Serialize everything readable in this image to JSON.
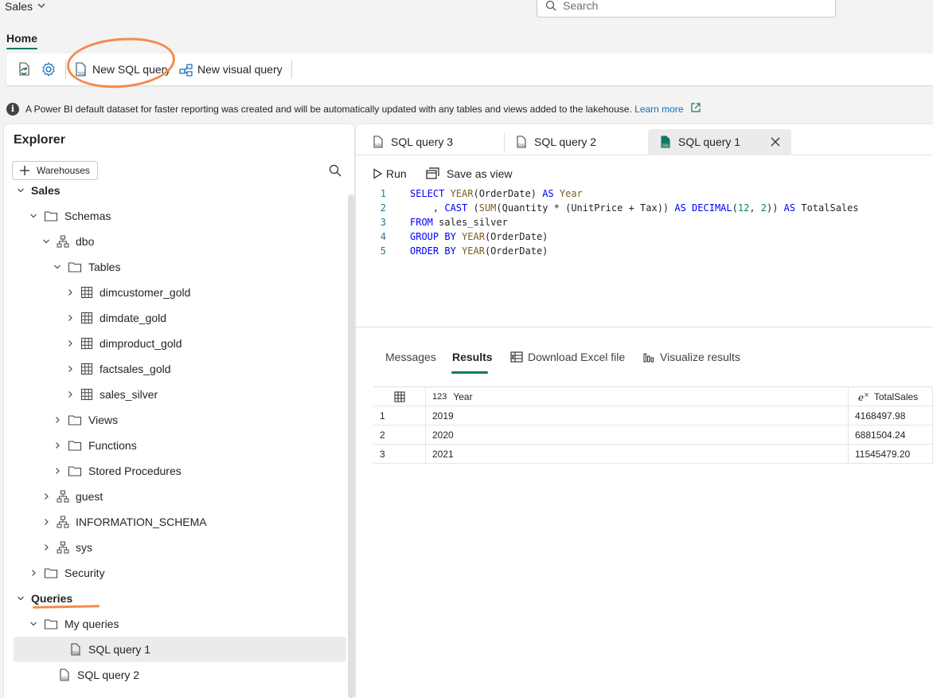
{
  "app": {
    "title": "Sales"
  },
  "search": {
    "placeholder": "Search"
  },
  "ribbon": {
    "tab_home": "Home",
    "new_sql_query": "New SQL query",
    "new_visual_query": "New visual query"
  },
  "info": {
    "message": "A Power BI default dataset for faster reporting was created and will be automatically updated with any tables and views added to the lakehouse.",
    "learn_more": "Learn more"
  },
  "explorer": {
    "title": "Explorer",
    "warehouses_button": "Warehouses",
    "tree": [
      {
        "label": "Sales"
      },
      {
        "label": "Schemas"
      },
      {
        "label": "dbo"
      },
      {
        "label": "Tables"
      },
      {
        "label": "dimcustomer_gold"
      },
      {
        "label": "dimdate_gold"
      },
      {
        "label": "dimproduct_gold"
      },
      {
        "label": "factsales_gold"
      },
      {
        "label": "sales_silver"
      },
      {
        "label": "Views"
      },
      {
        "label": "Functions"
      },
      {
        "label": "Stored Procedures"
      },
      {
        "label": "guest"
      },
      {
        "label": "INFORMATION_SCHEMA"
      },
      {
        "label": "sys"
      },
      {
        "label": "Security"
      },
      {
        "label": "Queries"
      },
      {
        "label": "My queries"
      },
      {
        "label": "SQL query 1"
      },
      {
        "label": "SQL query 2"
      }
    ]
  },
  "query_tabs": [
    {
      "label": "SQL query 3"
    },
    {
      "label": "SQL query 2"
    },
    {
      "label": "SQL query 1",
      "active": true
    }
  ],
  "editor_toolbar": {
    "run": "Run",
    "save_as_view": "Save as view"
  },
  "editor": {
    "lines": [
      {
        "num": "1",
        "parts": [
          [
            "kw",
            "SELECT "
          ],
          [
            "fn",
            "YEAR"
          ],
          [
            "",
            "(OrderDate) "
          ],
          [
            "kw",
            "AS "
          ],
          [
            "fn",
            "Year"
          ]
        ]
      },
      {
        "num": "2",
        "parts": [
          [
            "",
            "    , "
          ],
          [
            "kw",
            "CAST "
          ],
          [
            "",
            "("
          ],
          [
            "fn",
            "SUM"
          ],
          [
            "",
            "(Quantity * (UnitPrice + Tax)) "
          ],
          [
            "kw",
            "AS DECIMAL"
          ],
          [
            "",
            "("
          ],
          [
            "num",
            "12"
          ],
          [
            "",
            ", "
          ],
          [
            "num",
            "2"
          ],
          [
            "",
            "))"
          ],
          [
            "kw",
            " AS "
          ],
          [
            "",
            "TotalSales"
          ]
        ]
      },
      {
        "num": "3",
        "parts": [
          [
            "kw",
            "FROM "
          ],
          [
            "",
            "sales_silver"
          ]
        ]
      },
      {
        "num": "4",
        "parts": [
          [
            "kw",
            "GROUP BY "
          ],
          [
            "fn",
            "YEAR"
          ],
          [
            "",
            "(OrderDate)"
          ]
        ]
      },
      {
        "num": "5",
        "parts": [
          [
            "kw",
            "ORDER BY "
          ],
          [
            "fn",
            "YEAR"
          ],
          [
            "",
            "(OrderDate)"
          ]
        ]
      }
    ]
  },
  "results_tabs": {
    "messages": "Messages",
    "results": "Results",
    "download_excel": "Download Excel file",
    "visualize": "Visualize results"
  },
  "grid": {
    "type_year": "123",
    "col_year": "Year",
    "type_total": "e",
    "col_total": "TotalSales",
    "rows": [
      {
        "row": "1",
        "year": "2019",
        "total": "4168497.98"
      },
      {
        "row": "2",
        "year": "2020",
        "total": "6881504.24"
      },
      {
        "row": "3",
        "year": "2021",
        "total": "11545479.20"
      }
    ]
  },
  "colors": {
    "accent": "#117865",
    "annotation": "#f58a4b",
    "link": "#0f6cbd"
  }
}
